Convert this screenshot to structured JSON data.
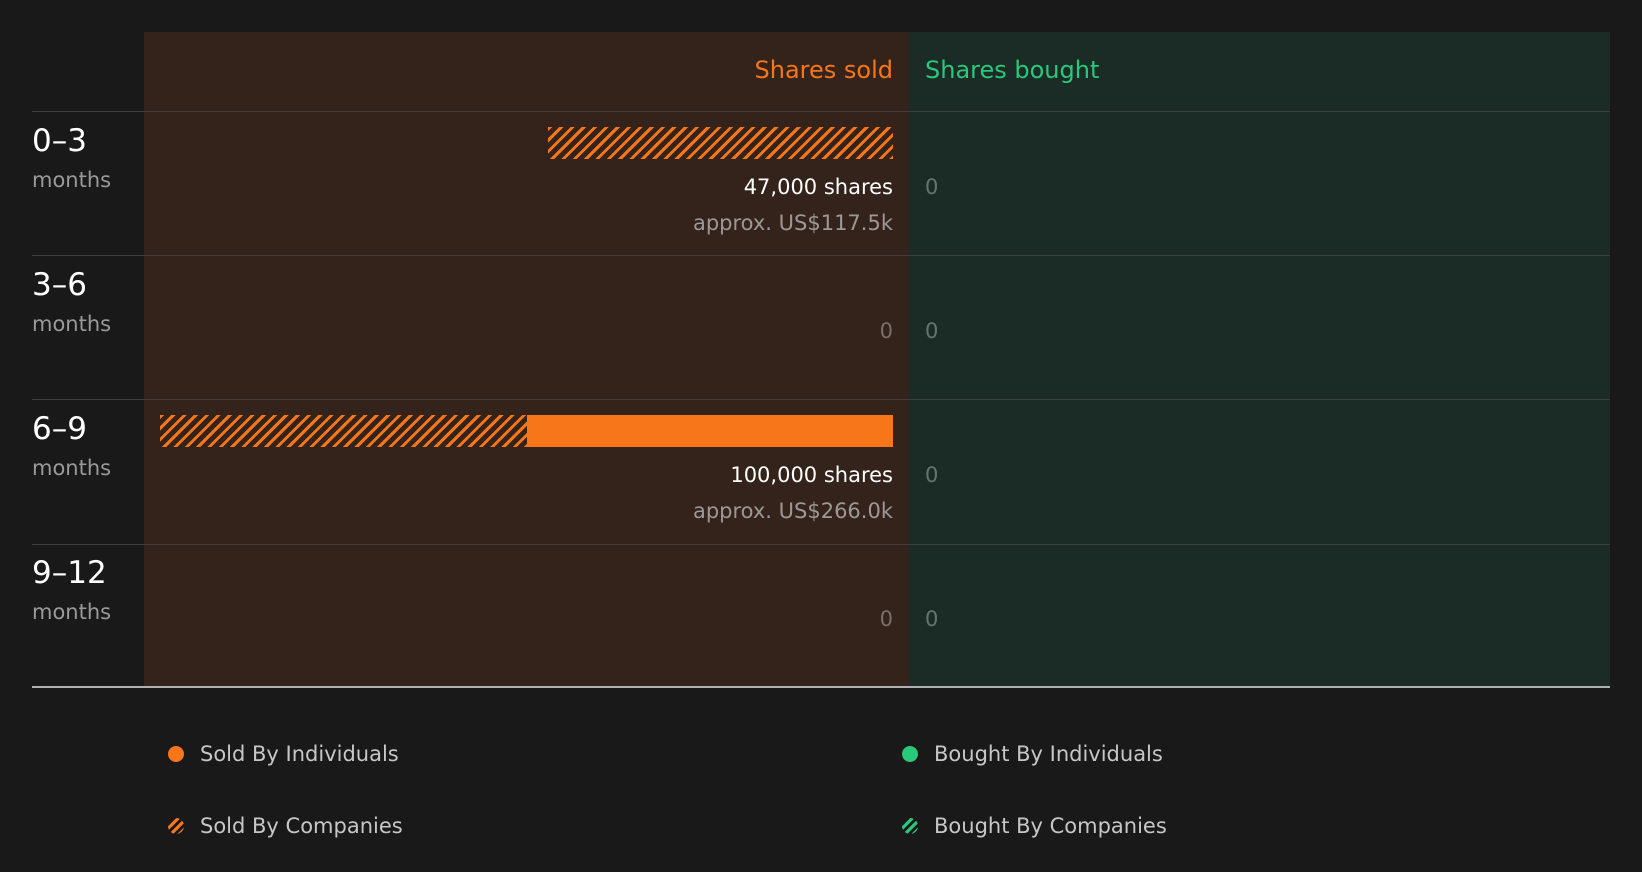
{
  "chart_data": {
    "type": "bar",
    "orientation": "horizontal",
    "headers": {
      "sold": "Shares sold",
      "bought": "Shares bought"
    },
    "colors": {
      "sold": "#f7761a",
      "bought": "#2bc77b"
    },
    "max_shares": 100000,
    "rows": [
      {
        "range": "0–3",
        "unit": "months",
        "sold": {
          "individuals": 0,
          "companies": 47000,
          "shares_label": "47,000 shares",
          "value_label": "approx. US$117.5k",
          "zero_label": ""
        },
        "bought": {
          "label": "0"
        }
      },
      {
        "range": "3–6",
        "unit": "months",
        "sold": {
          "individuals": 0,
          "companies": 0,
          "shares_label": "",
          "value_label": "",
          "zero_label": "0"
        },
        "bought": {
          "label": "0"
        }
      },
      {
        "range": "6–9",
        "unit": "months",
        "sold": {
          "individuals": 50000,
          "companies": 50000,
          "shares_label": "100,000 shares",
          "value_label": "approx. US$266.0k",
          "zero_label": ""
        },
        "bought": {
          "label": "0"
        }
      },
      {
        "range": "9–12",
        "unit": "months",
        "sold": {
          "individuals": 0,
          "companies": 0,
          "shares_label": "",
          "value_label": "",
          "zero_label": "0"
        },
        "bought": {
          "label": "0"
        }
      }
    ],
    "legend": [
      {
        "label": "Sold By Individuals"
      },
      {
        "label": "Bought By Individuals"
      },
      {
        "label": "Sold By Companies"
      },
      {
        "label": "Bought By Companies"
      }
    ]
  }
}
